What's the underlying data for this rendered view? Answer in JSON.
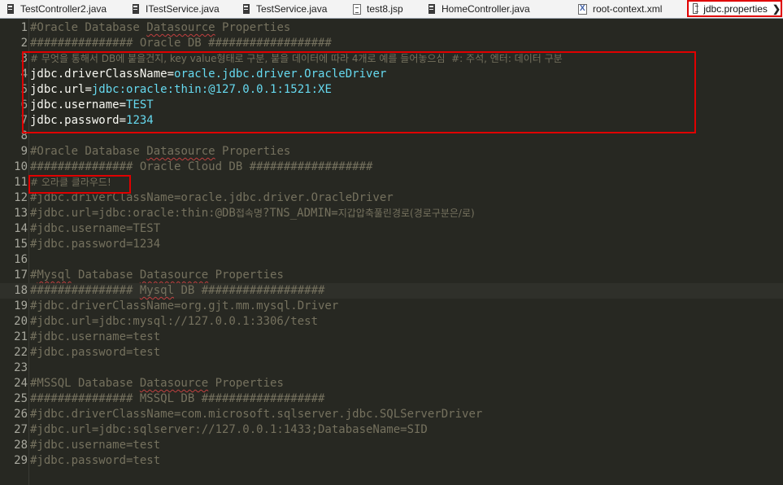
{
  "tabs": [
    {
      "label": "TestController2.java",
      "icon": "java-file-icon",
      "active": false
    },
    {
      "label": "ITestService.java",
      "icon": "java-file-icon",
      "active": false
    },
    {
      "label": "TestService.java",
      "icon": "java-file-icon",
      "active": false
    },
    {
      "label": "test8.jsp",
      "icon": "jsp-file-icon",
      "active": false
    },
    {
      "label": "HomeController.java",
      "icon": "java-file-icon",
      "active": false
    },
    {
      "label": "root-context.xml",
      "icon": "xml-file-icon",
      "active": false
    },
    {
      "label": "jdbc.properties",
      "icon": "properties-file-icon",
      "active": true
    }
  ],
  "tab_chevron": "❯",
  "editor": {
    "current_line": 18,
    "lines": [
      {
        "n": "1",
        "segs": [
          [
            "c",
            "#Oracle Database "
          ],
          [
            "cs",
            "Datasource"
          ],
          [
            "c",
            " Properties"
          ]
        ]
      },
      {
        "n": "2",
        "segs": [
          [
            "c",
            "############### Oracle DB ##################"
          ]
        ]
      },
      {
        "n": "3",
        "segs": [
          [
            "ck",
            "# 무엇을 통해서 DB에 붙을건지, key value형태로 구분, 붙을 데이터에 따라 4개로 예를 들어놓으심  #: 주석, 엔터: 데이터 구분"
          ]
        ]
      },
      {
        "n": "4",
        "segs": [
          [
            "k",
            "jdbc.driverClassName"
          ],
          [
            "k",
            "="
          ],
          [
            "v",
            "oracle.jdbc.driver.OracleDriver"
          ]
        ]
      },
      {
        "n": "5",
        "segs": [
          [
            "k",
            "jdbc.url"
          ],
          [
            "k",
            "="
          ],
          [
            "v",
            "jdbc:oracle:thin:@127.0.0.1:1521:XE"
          ]
        ]
      },
      {
        "n": "6",
        "segs": [
          [
            "k",
            "jdbc.username"
          ],
          [
            "k",
            "="
          ],
          [
            "v",
            "TEST"
          ]
        ]
      },
      {
        "n": "7",
        "segs": [
          [
            "k",
            "jdbc.password"
          ],
          [
            "k",
            "="
          ],
          [
            "v",
            "1234"
          ]
        ]
      },
      {
        "n": "8",
        "segs": []
      },
      {
        "n": "9",
        "segs": [
          [
            "c",
            "#Oracle Database "
          ],
          [
            "cs",
            "Datasource"
          ],
          [
            "c",
            " Properties"
          ]
        ]
      },
      {
        "n": "10",
        "segs": [
          [
            "c",
            "############### Oracle Cloud DB ##################"
          ]
        ]
      },
      {
        "n": "11",
        "segs": [
          [
            "ck",
            "# 오라클 클라우드!"
          ]
        ]
      },
      {
        "n": "12",
        "segs": [
          [
            "c",
            "#jdbc.driverClassName=oracle.jdbc.driver.OracleDriver"
          ]
        ]
      },
      {
        "n": "13",
        "segs": [
          [
            "c",
            "#jdbc.url=jdbc:oracle:thin:@DB"
          ],
          [
            "ck",
            "접속명"
          ],
          [
            "c",
            "?TNS_ADMIN="
          ],
          [
            "ck",
            "지갑압축풀린경로(경로구분은/로)"
          ]
        ]
      },
      {
        "n": "14",
        "segs": [
          [
            "c",
            "#jdbc.username=TEST"
          ]
        ]
      },
      {
        "n": "15",
        "segs": [
          [
            "c",
            "#jdbc.password=1234"
          ]
        ]
      },
      {
        "n": "16",
        "segs": []
      },
      {
        "n": "17",
        "segs": [
          [
            "c",
            "#"
          ],
          [
            "cs",
            "Mysql"
          ],
          [
            "c",
            " Database "
          ],
          [
            "cs",
            "Datasource"
          ],
          [
            "c",
            " Properties"
          ]
        ]
      },
      {
        "n": "18",
        "segs": [
          [
            "c",
            "############### "
          ],
          [
            "cs",
            "Mysql"
          ],
          [
            "c",
            " DB ##################"
          ]
        ]
      },
      {
        "n": "19",
        "segs": [
          [
            "c",
            "#jdbc.driverClassName=org.gjt.mm.mysql.Driver"
          ]
        ]
      },
      {
        "n": "20",
        "segs": [
          [
            "c",
            "#jdbc.url=jdbc:mysql://127.0.0.1:3306/test"
          ]
        ]
      },
      {
        "n": "21",
        "segs": [
          [
            "c",
            "#jdbc.username=test"
          ]
        ]
      },
      {
        "n": "22",
        "segs": [
          [
            "c",
            "#jdbc.password=test"
          ]
        ]
      },
      {
        "n": "23",
        "segs": []
      },
      {
        "n": "24",
        "segs": [
          [
            "c",
            "#MSSQL Database "
          ],
          [
            "cs",
            "Datasource"
          ],
          [
            "c",
            " Properties"
          ]
        ]
      },
      {
        "n": "25",
        "segs": [
          [
            "c",
            "############### MSSQL DB ##################"
          ]
        ]
      },
      {
        "n": "26",
        "segs": [
          [
            "c",
            "#jdbc.driverClassName=com.microsoft.sqlserver.jdbc.SQLServerDriver"
          ]
        ]
      },
      {
        "n": "27",
        "segs": [
          [
            "c",
            "#jdbc.url=jdbc:sqlserver://127.0.0.1:1433;DatabaseName=SID"
          ]
        ]
      },
      {
        "n": "28",
        "segs": [
          [
            "c",
            "#jdbc.username=test"
          ]
        ]
      },
      {
        "n": "29",
        "segs": [
          [
            "c",
            "#jdbc.password=test"
          ]
        ]
      }
    ]
  },
  "colors": {
    "background": "#272822",
    "comment": "#75715e",
    "key": "#f8f8f2",
    "value": "#66d9ef",
    "highlight_box": "#e00000"
  }
}
